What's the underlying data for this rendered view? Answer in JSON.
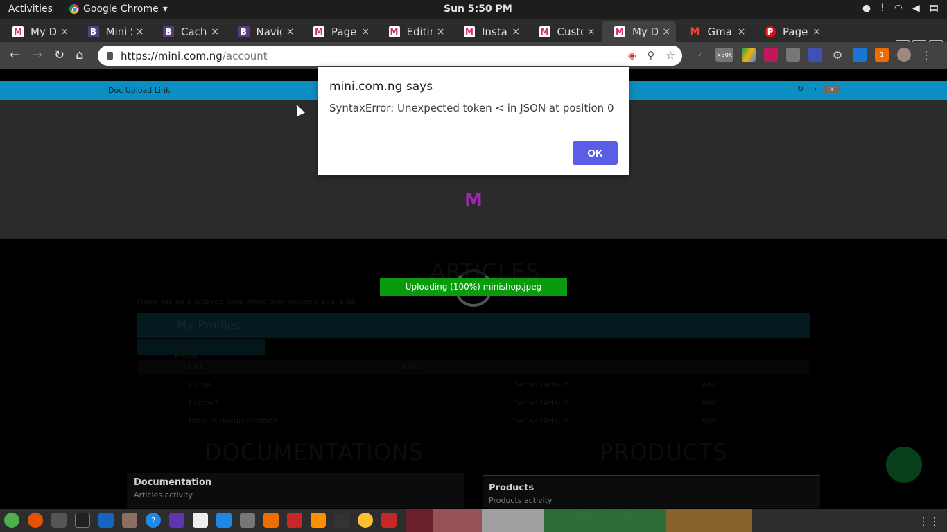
{
  "system": {
    "activities": "Activities",
    "app_name": "Google Chrome",
    "clock": "Sun  5:50 PM",
    "tray": [
      "github-icon",
      "warning-icon",
      "wifi-icon",
      "volume-icon",
      "clipboard-icon"
    ],
    "warning_text": "!"
  },
  "tabs": [
    {
      "title": "My Da",
      "favicon": "M",
      "favicon_type": "m"
    },
    {
      "title": "Mini Sl",
      "favicon": "B",
      "favicon_type": "b"
    },
    {
      "title": "Cache",
      "favicon": "B",
      "favicon_type": "b"
    },
    {
      "title": "Naviga",
      "favicon": "B",
      "favicon_type": "b"
    },
    {
      "title": "Page M",
      "favicon": "M",
      "favicon_type": "m"
    },
    {
      "title": "Editin",
      "favicon": "M",
      "favicon_type": "m"
    },
    {
      "title": "Install",
      "favicon": "M",
      "favicon_type": "m"
    },
    {
      "title": "Custo",
      "favicon": "M",
      "favicon_type": "m"
    },
    {
      "title": "My Da",
      "favicon": "M",
      "favicon_type": "m",
      "active": true
    },
    {
      "title": "Gmail",
      "favicon": "M",
      "favicon_type": "g"
    },
    {
      "title": "PageC",
      "favicon": "P",
      "favicon_type": "p"
    }
  ],
  "tab_close_glyph": "×",
  "newtab_glyph": "+",
  "toolbar": {
    "url_host": "https://mini.com.ng",
    "url_path": "/account",
    "extension_badge": ">30K",
    "extension_badge2": "1"
  },
  "page": {
    "doc_upload_link": "Doc Upload Link",
    "header_close": "x",
    "refresh_glyph": "↻",
    "arrow_glyph": "→",
    "articles_title": "ARTICLES",
    "articles_note": "There will be displayed here when they become available",
    "my_profiles": "My Profiles",
    "add_profile": "Create a Profile",
    "col_url": "URL",
    "col_type": "TYPE",
    "rows": [
      {
        "name": "Home",
        "action": "Set as Default",
        "status": "Add"
      },
      {
        "name": "Contact",
        "action": "Set as Default",
        "status": "Add"
      },
      {
        "name": "Product documentation",
        "action": "Set as Default",
        "status": "Add"
      }
    ],
    "documentations_title": "DOCUMENTATIONS",
    "products_title": "PRODUCTS",
    "doc_card_title": "Documentation",
    "doc_card_sub": "Articles activity",
    "prod_card_title": "Products",
    "prod_card_sub": "Products activity",
    "upload_status": "Uploading (100%) minishop.jpeg",
    "upload_progress": 1.0
  },
  "dialog": {
    "title": "mini.com.ng says",
    "message": "SyntaxError: Unexpected token < in JSON at position 0",
    "ok_label": "OK"
  }
}
